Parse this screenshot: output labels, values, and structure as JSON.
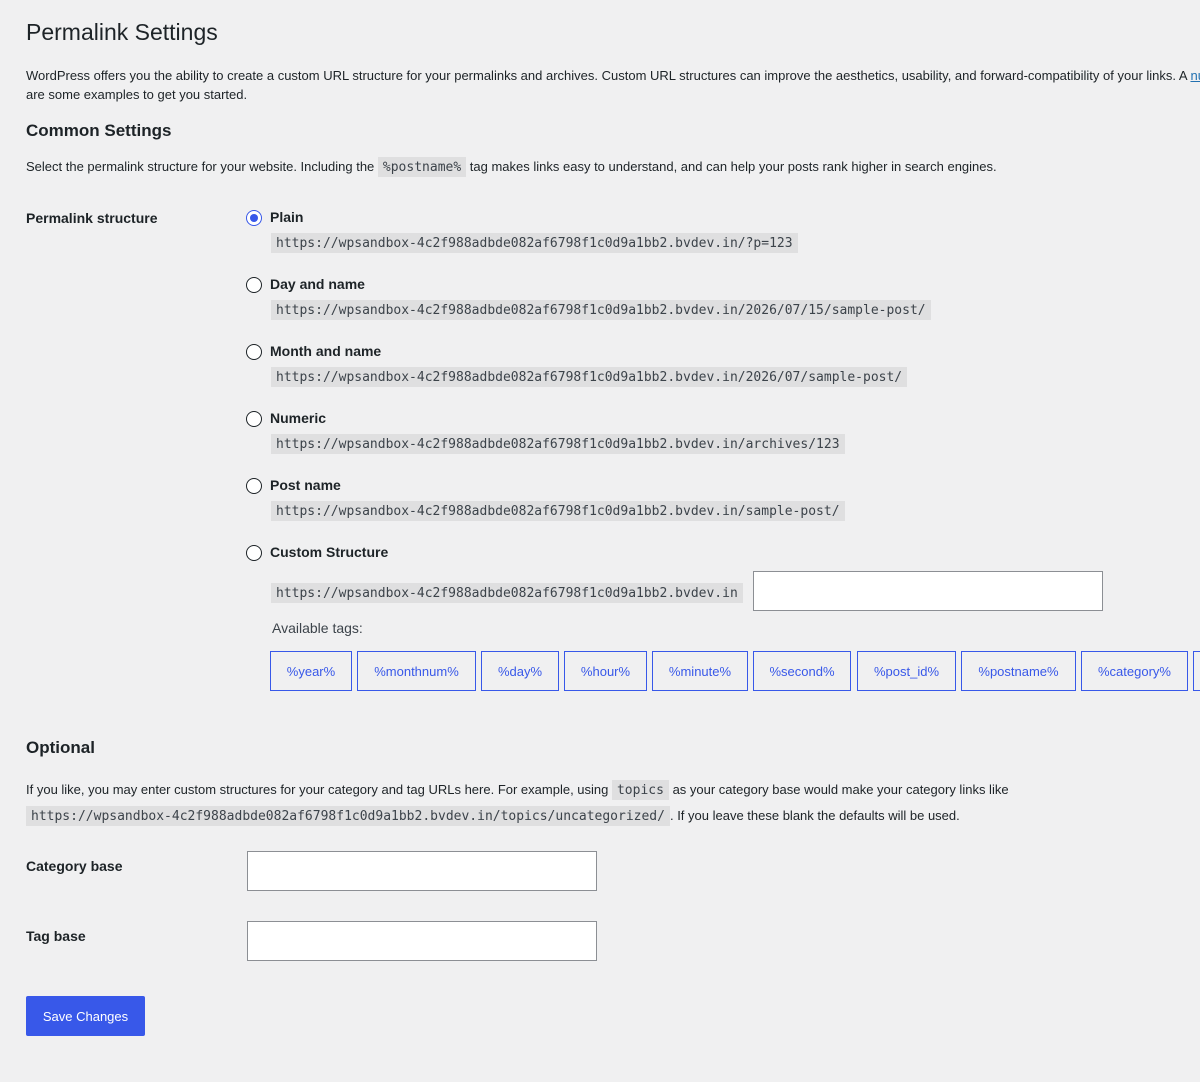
{
  "page_title": "Permalink Settings",
  "intro": {
    "text": "WordPress offers you the ability to create a custom URL structure for your permalinks and archives. Custom URL structures can improve the aesthetics, usability, and forward-compatibility of your links. A ",
    "link_text": "nu",
    "line2": "are some examples to get you started."
  },
  "common": {
    "heading": "Common Settings",
    "desc_before": "Select the permalink structure for your website. Including the ",
    "desc_code": "%postname%",
    "desc_after": " tag makes links easy to understand, and can help your posts rank higher in search engines.",
    "structure_label": "Permalink structure",
    "options": [
      {
        "label": "Plain",
        "example": "https://wpsandbox-4c2f988adbde082af6798f1c0d9a1bb2.bvdev.in/?p=123",
        "checked": true
      },
      {
        "label": "Day and name",
        "example": "https://wpsandbox-4c2f988adbde082af6798f1c0d9a1bb2.bvdev.in/2026/07/15/sample-post/",
        "checked": false
      },
      {
        "label": "Month and name",
        "example": "https://wpsandbox-4c2f988adbde082af6798f1c0d9a1bb2.bvdev.in/2026/07/sample-post/",
        "checked": false
      },
      {
        "label": "Numeric",
        "example": "https://wpsandbox-4c2f988adbde082af6798f1c0d9a1bb2.bvdev.in/archives/123",
        "checked": false
      },
      {
        "label": "Post name",
        "example": "https://wpsandbox-4c2f988adbde082af6798f1c0d9a1bb2.bvdev.in/sample-post/",
        "checked": false
      },
      {
        "label": "Custom Structure",
        "example": "https://wpsandbox-4c2f988adbde082af6798f1c0d9a1bb2.bvdev.in",
        "checked": false
      }
    ],
    "custom_value": "",
    "available_tags_label": "Available tags:",
    "tags": [
      "%year%",
      "%monthnum%",
      "%day%",
      "%hour%",
      "%minute%",
      "%second%",
      "%post_id%",
      "%postname%",
      "%category%"
    ]
  },
  "optional": {
    "heading": "Optional",
    "desc_before": "If you like, you may enter custom structures for your category and tag URLs here. For example, using ",
    "desc_code": "topics",
    "desc_after": " as your category base would make your category links like",
    "example_code": "https://wpsandbox-4c2f988adbde082af6798f1c0d9a1bb2.bvdev.in/topics/uncategorized/",
    "example_after": ". If you leave these blank the defaults will be used.",
    "category_base_label": "Category base",
    "category_base_value": "",
    "tag_base_label": "Tag base",
    "tag_base_value": ""
  },
  "save_label": "Save Changes",
  "colors": {
    "accent": "#3858e9",
    "background": "#f0f0f1",
    "text": "#1d2327"
  }
}
